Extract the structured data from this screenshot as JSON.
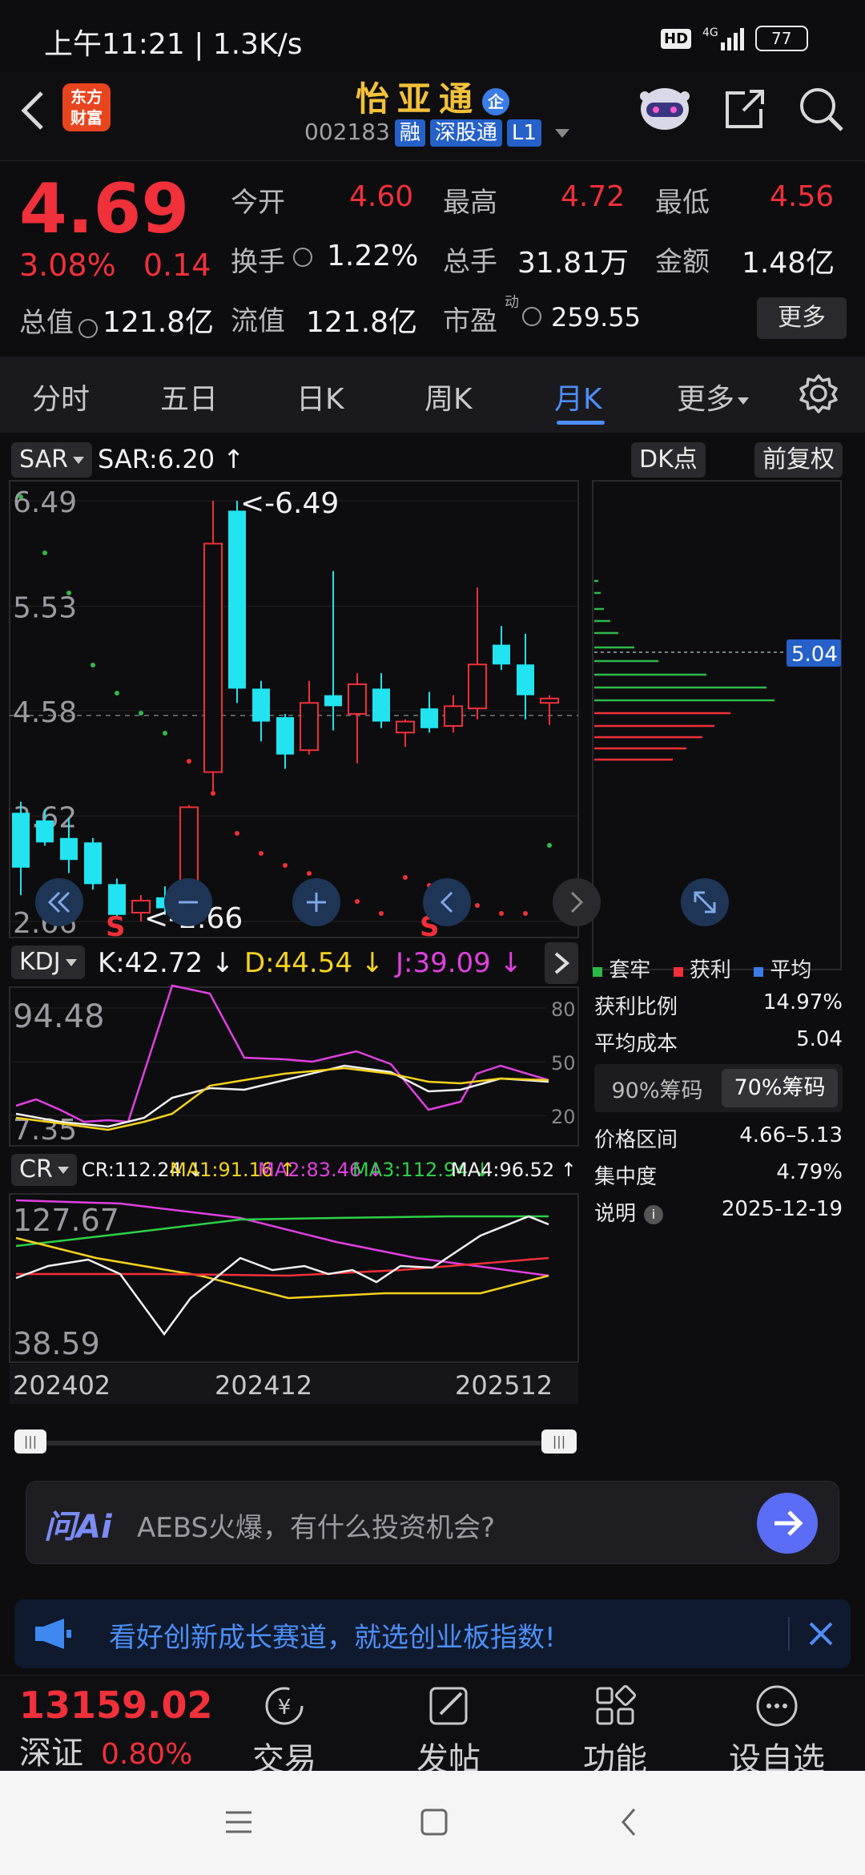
{
  "status_bar": {
    "time": "上午11:21 | 1.3K/s",
    "hd": "HD",
    "network": "4G",
    "battery": "77"
  },
  "header": {
    "logo_line1": "东方",
    "logo_line2": "财富",
    "stock_name": "怡亚通",
    "enterprise_badge": "企",
    "stock_code": "002183",
    "tags": [
      "融",
      "深股通",
      "L1"
    ]
  },
  "quote": {
    "price": "4.69",
    "change_pct": "3.08%",
    "change": "0.14",
    "open_label": "今开",
    "open": "4.60",
    "high_label": "最高",
    "high": "4.72",
    "low_label": "最低",
    "low": "4.56",
    "turnover_label": "换手",
    "turnover": "1.22%",
    "volume_label": "总手",
    "volume": "31.81万",
    "amount_label": "金额",
    "amount": "1.48亿",
    "mcap_label": "总值",
    "mcap": "121.8亿",
    "float_label": "流值",
    "float": "121.8亿",
    "pe_label": "市盈",
    "pe_sup": "动",
    "pe": "259.55",
    "more": "更多"
  },
  "tabs": [
    "分时",
    "五日",
    "日K",
    "周K",
    "月K",
    "更多",
    "settings-icon"
  ],
  "chart_controls": {
    "indicator": "SAR",
    "indicator_value": "SAR:6.20 ↑",
    "dk_button": "DK点",
    "adjust_button": "前复权"
  },
  "chart_data": {
    "type": "candlestick",
    "y_ticks": [
      "6.49",
      "5.53",
      "4.58",
      "3.62",
      "2.66"
    ],
    "ylim": [
      2.66,
      6.49
    ],
    "x_ticks": [
      "202402",
      "202412",
      "202512"
    ],
    "annotations": [
      "<-6.49",
      "<-2.66"
    ],
    "sell_markers": [
      "S",
      "S"
    ],
    "chip_avg_label": "5.04",
    "candles": [
      {
        "o": 3.65,
        "h": 3.75,
        "l": 2.9,
        "c": 3.15
      },
      {
        "o": 3.58,
        "h": 3.68,
        "l": 3.35,
        "c": 3.38
      },
      {
        "o": 3.42,
        "h": 3.6,
        "l": 3.1,
        "c": 3.22
      },
      {
        "o": 3.38,
        "h": 3.42,
        "l": 2.95,
        "c": 3.0
      },
      {
        "o": 3.0,
        "h": 3.05,
        "l": 2.7,
        "c": 2.72
      },
      {
        "o": 2.74,
        "h": 2.9,
        "l": 2.66,
        "c": 2.85
      },
      {
        "o": 2.88,
        "h": 2.98,
        "l": 2.72,
        "c": 2.78
      },
      {
        "o": 2.78,
        "h": 3.72,
        "l": 2.75,
        "c": 3.7
      },
      {
        "o": 4.02,
        "h": 6.49,
        "l": 3.85,
        "c": 6.1
      },
      {
        "o": 6.4,
        "h": 6.49,
        "l": 4.65,
        "c": 4.78
      },
      {
        "o": 4.78,
        "h": 4.85,
        "l": 4.3,
        "c": 4.48
      },
      {
        "o": 4.52,
        "h": 4.55,
        "l": 4.05,
        "c": 4.18
      },
      {
        "o": 4.22,
        "h": 4.85,
        "l": 4.18,
        "c": 4.65
      },
      {
        "o": 4.72,
        "h": 5.85,
        "l": 4.4,
        "c": 4.62
      },
      {
        "o": 4.55,
        "h": 4.92,
        "l": 4.1,
        "c": 4.82
      },
      {
        "o": 4.78,
        "h": 4.92,
        "l": 4.42,
        "c": 4.48
      },
      {
        "o": 4.38,
        "h": 4.5,
        "l": 4.25,
        "c": 4.48
      },
      {
        "o": 4.6,
        "h": 4.75,
        "l": 4.38,
        "c": 4.42
      },
      {
        "o": 4.44,
        "h": 4.72,
        "l": 4.38,
        "c": 4.62
      },
      {
        "o": 4.6,
        "h": 5.7,
        "l": 4.5,
        "c": 5.0
      },
      {
        "o": 5.18,
        "h": 5.35,
        "l": 4.95,
        "c": 5.0
      },
      {
        "o": 5.0,
        "h": 5.28,
        "l": 4.5,
        "c": 4.72
      },
      {
        "o": 4.65,
        "h": 4.72,
        "l": 4.45,
        "c": 4.69
      }
    ]
  },
  "kdj": {
    "name": "KDJ",
    "k": "K:42.72 ↓",
    "d": "D:44.54 ↓",
    "j": "J:39.09 ↓",
    "top_value": "94.48",
    "bottom_value": "7.35",
    "levels": [
      "80",
      "50",
      "20"
    ]
  },
  "cr": {
    "name": "CR",
    "cr": "CR:112.24 ↓",
    "ma1": "MA1:91.16 ↑",
    "ma2": "MA2:83.46 ↓",
    "ma3": "MA3:112.94 ↓",
    "ma4": "MA4:96.52 ↑",
    "top_value": "127.67",
    "bottom_value": "38.59"
  },
  "chip_panel": {
    "legend": [
      "套牢",
      "获利",
      "平均"
    ],
    "rows": [
      {
        "label": "获利比例",
        "value": "14.97%"
      },
      {
        "label": "平均成本",
        "value": "5.04"
      }
    ],
    "tabs": [
      "90%筹码",
      "70%筹码"
    ],
    "rows2": [
      {
        "label": "价格区间",
        "value": "4.66–5.13"
      },
      {
        "label": "集中度",
        "value": "4.79%"
      },
      {
        "label": "说明",
        "value": "2025-12-19"
      }
    ]
  },
  "ai_bar": {
    "brand": "问Ai",
    "placeholder": "AEBS火爆，有什么投资机会?"
  },
  "banner": {
    "text": "看好创新成长赛道，就选创业板指数!"
  },
  "bottom_nav": {
    "index_value": "13159.02",
    "index_name": "深证",
    "index_change": "0.80%",
    "items": [
      "交易",
      "发帖",
      "功能",
      "设自选"
    ]
  },
  "colors": {
    "up": "#f0303a",
    "down": "#22e3f0",
    "accent": "#4d8ef7",
    "brand_yellow": "#f2c13a"
  }
}
